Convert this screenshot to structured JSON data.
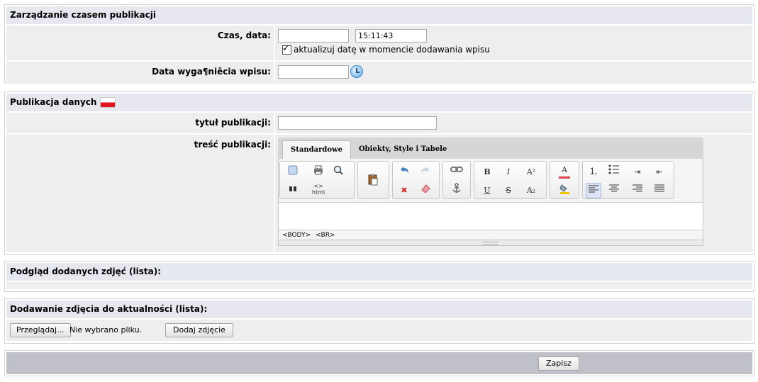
{
  "section_time": {
    "title": "Zarządzanie czasem publikacji",
    "date_label": "Czas, data:",
    "date_value": "",
    "time_value": "15:11:43",
    "update_checkbox_label": "aktualizuj datę w momencie dodawania wpisu",
    "update_checked": true,
    "expiry_label": "Data wyga¶niêcia wpisu:",
    "expiry_value": ""
  },
  "section_publication": {
    "title": "Publikacja danych",
    "flag_icon": "poland-flag-icon",
    "title_field_label": "tytuł publikacji:",
    "title_field_value": "",
    "content_label": "treść publikacji:",
    "editor": {
      "tabs": [
        "Standardowe",
        "Obiekty, Style i Tabele"
      ],
      "active_tab": 0,
      "status_path": [
        "<BODY>",
        "<BR>"
      ],
      "underline_color": "#e0444e",
      "highlight_color": "#f2c400"
    }
  },
  "section_gallery": {
    "title": "Podgląd dodanych zdjęć (lista):"
  },
  "section_upload": {
    "title": "Dodawanie zdjęcia do aktualności (lista):",
    "browse_label": "Przeglądaj...",
    "no_file_text": "Nie wybrano pliku.",
    "add_photo_label": "Dodaj zdjęcie"
  },
  "save": {
    "label": "Zapisz"
  }
}
